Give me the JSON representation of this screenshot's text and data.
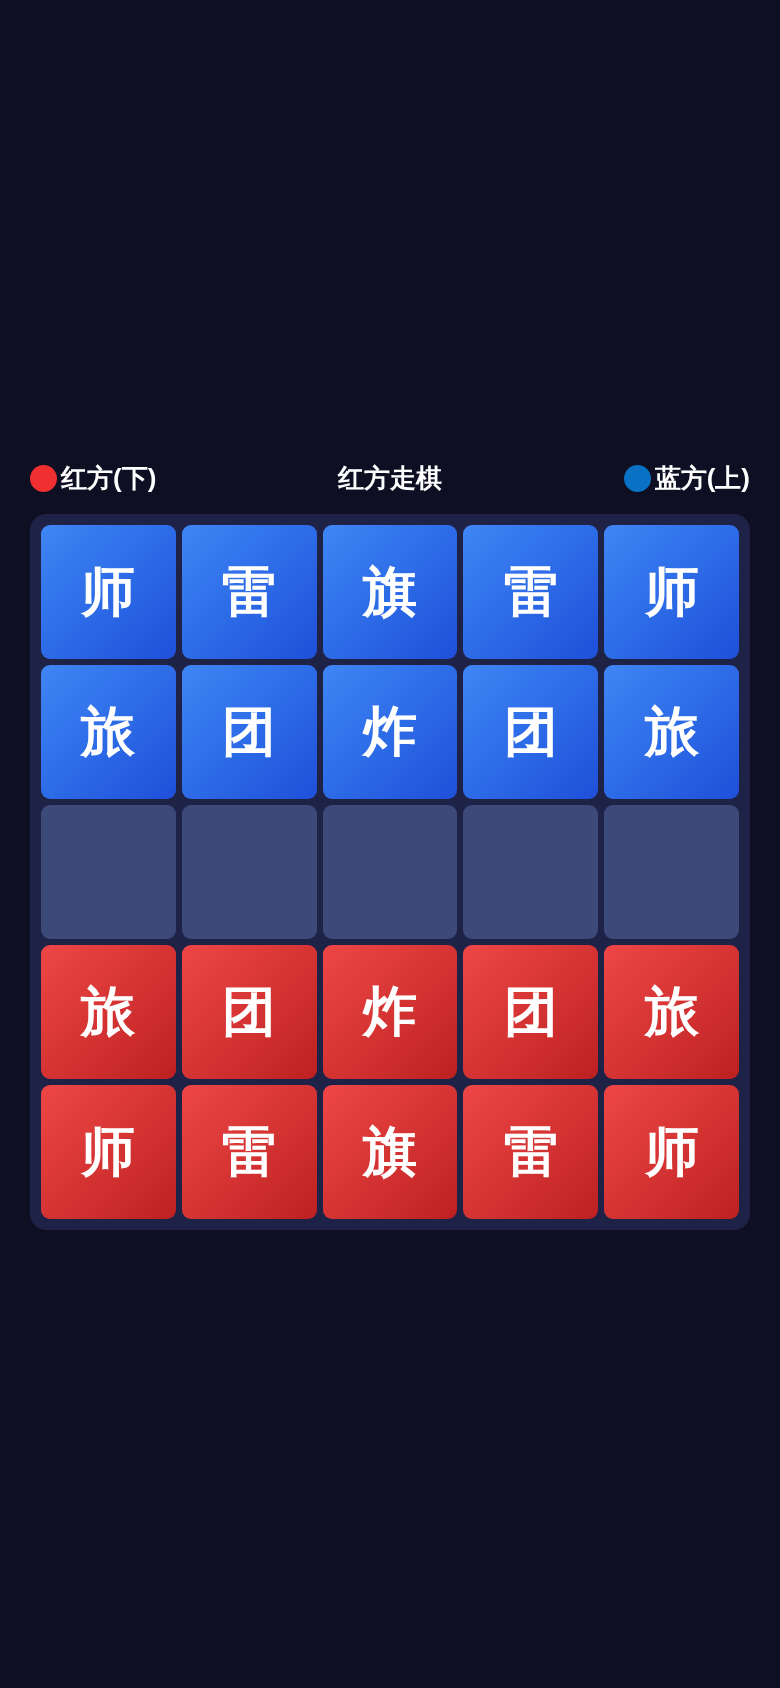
{
  "header": {
    "players": [
      {
        "label": "红方(下)",
        "color": "#f03030"
      },
      {
        "label": "蓝方(上)",
        "color": "#0a72c4"
      }
    ],
    "status": "红方走棋"
  },
  "board": {
    "rows": [
      [
        {
          "kind": "blue",
          "piece": "师"
        },
        {
          "kind": "blue",
          "piece": "雷"
        },
        {
          "kind": "blue",
          "piece": "旗"
        },
        {
          "kind": "blue",
          "piece": "雷"
        },
        {
          "kind": "blue",
          "piece": "师"
        }
      ],
      [
        {
          "kind": "blue",
          "piece": "旅"
        },
        {
          "kind": "blue",
          "piece": "团"
        },
        {
          "kind": "blue",
          "piece": "炸"
        },
        {
          "kind": "blue",
          "piece": "团"
        },
        {
          "kind": "blue",
          "piece": "旅"
        }
      ],
      [
        {
          "kind": "empty"
        },
        {
          "kind": "empty"
        },
        {
          "kind": "empty"
        },
        {
          "kind": "empty"
        },
        {
          "kind": "empty"
        }
      ],
      [
        {
          "kind": "red",
          "piece": "旅"
        },
        {
          "kind": "red",
          "piece": "团"
        },
        {
          "kind": "red",
          "piece": "炸"
        },
        {
          "kind": "red",
          "piece": "团"
        },
        {
          "kind": "red",
          "piece": "旅"
        }
      ],
      [
        {
          "kind": "red",
          "piece": "师"
        },
        {
          "kind": "red",
          "piece": "雷"
        },
        {
          "kind": "red",
          "piece": "旗"
        },
        {
          "kind": "red",
          "piece": "雷"
        },
        {
          "kind": "red",
          "piece": "师"
        }
      ]
    ]
  }
}
